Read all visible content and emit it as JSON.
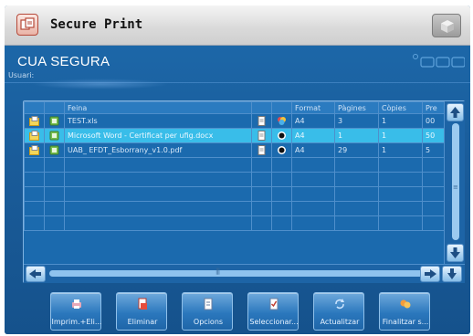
{
  "app": {
    "title": "Secure Print",
    "icon": "print-job-icon",
    "home_icon": "home-cube-icon"
  },
  "section": {
    "title": "CUA SEGURA",
    "user_label": "Usuari:"
  },
  "table": {
    "columns": [
      "Feina",
      "Format",
      "Pàgines",
      "Còpies",
      "Pre"
    ],
    "rows": [
      {
        "name": "TEST.xls",
        "format": "A4",
        "pages": "3",
        "copies": "1",
        "pre": "00",
        "selected": false,
        "status_icon": "color-print-icon"
      },
      {
        "name": "Microsoft Word - Certificat per ufig.docx",
        "format": "A4",
        "pages": "1",
        "copies": "1",
        "pre": "50",
        "selected": true,
        "status_icon": "bw-print-icon"
      },
      {
        "name": "UAB_ EFDT_Esborrany_v1.0.pdf",
        "format": "A4",
        "pages": "29",
        "copies": "1",
        "pre": "5",
        "selected": false,
        "status_icon": "bw-print-icon"
      }
    ],
    "empty_rows": 5
  },
  "toolbar": {
    "buttons": [
      {
        "label": "Imprim.+Eli...",
        "icon": "print-delete-icon"
      },
      {
        "label": "Eliminar",
        "icon": "delete-icon"
      },
      {
        "label": "Opcions",
        "icon": "options-icon"
      },
      {
        "label": "Seleccionar...",
        "icon": "select-icon"
      },
      {
        "label": "Actualitzar",
        "icon": "refresh-icon"
      },
      {
        "label": "Finalitzar s...",
        "icon": "finish-session-icon"
      }
    ]
  },
  "colors": {
    "frame": "#1a5d9a",
    "selected_row": "#39bde9",
    "header": "#d9d9d9"
  }
}
